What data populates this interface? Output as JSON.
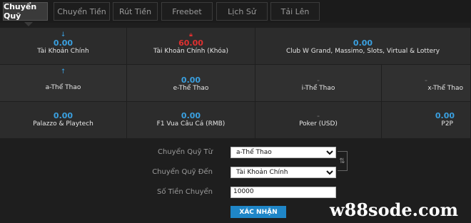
{
  "tabs": [
    "Chuyển Quỹ",
    "Chuyển Tiền",
    "Rút Tiền",
    "Freebet",
    "Lịch Sử",
    "Tải Lên"
  ],
  "row1": [
    {
      "value": "0.00",
      "label": "Tài Khoản Chính",
      "icon": "arrow-down-icon"
    },
    {
      "value": "60.00",
      "label": "Tài Khoản Chính (Khóa)",
      "icon": "lock-icon"
    },
    {
      "value": "0.00",
      "label": "Club W Grand, Massimo, Slots, Virtual & Lottery"
    }
  ],
  "row2": [
    {
      "value": "",
      "label": "a-Thể Thao",
      "icon": "arrow-up-icon"
    },
    {
      "value": "0.00",
      "label": "e-Thể Thao"
    },
    {
      "value": "-",
      "label": "i-Thể Thao"
    },
    {
      "value": "-",
      "label": "x-Thể Thao"
    }
  ],
  "row3": [
    {
      "value": "0.00",
      "label": "Palazzo & Playtech"
    },
    {
      "value": "0.00",
      "label": "F1 Vua Câu Cá (RMB)"
    },
    {
      "value": "-",
      "label": "Poker (USD)"
    },
    {
      "value": "0.00",
      "label": "P2P"
    }
  ],
  "form": {
    "from_label": "Chuyển Quỹ Từ",
    "from_value": "a-Thể Thao",
    "to_label": "Chuyển Quỹ Đến",
    "to_value": "Tài Khoản Chính",
    "amount_label": "Số Tiền Chuyển",
    "amount_value": "10000",
    "submit_label": "XÁC NHẬN"
  },
  "watermark": "w88sode.com",
  "colors": {
    "accent": "#3aa0e0",
    "locked": "#e03030",
    "button": "#1f86c8"
  }
}
